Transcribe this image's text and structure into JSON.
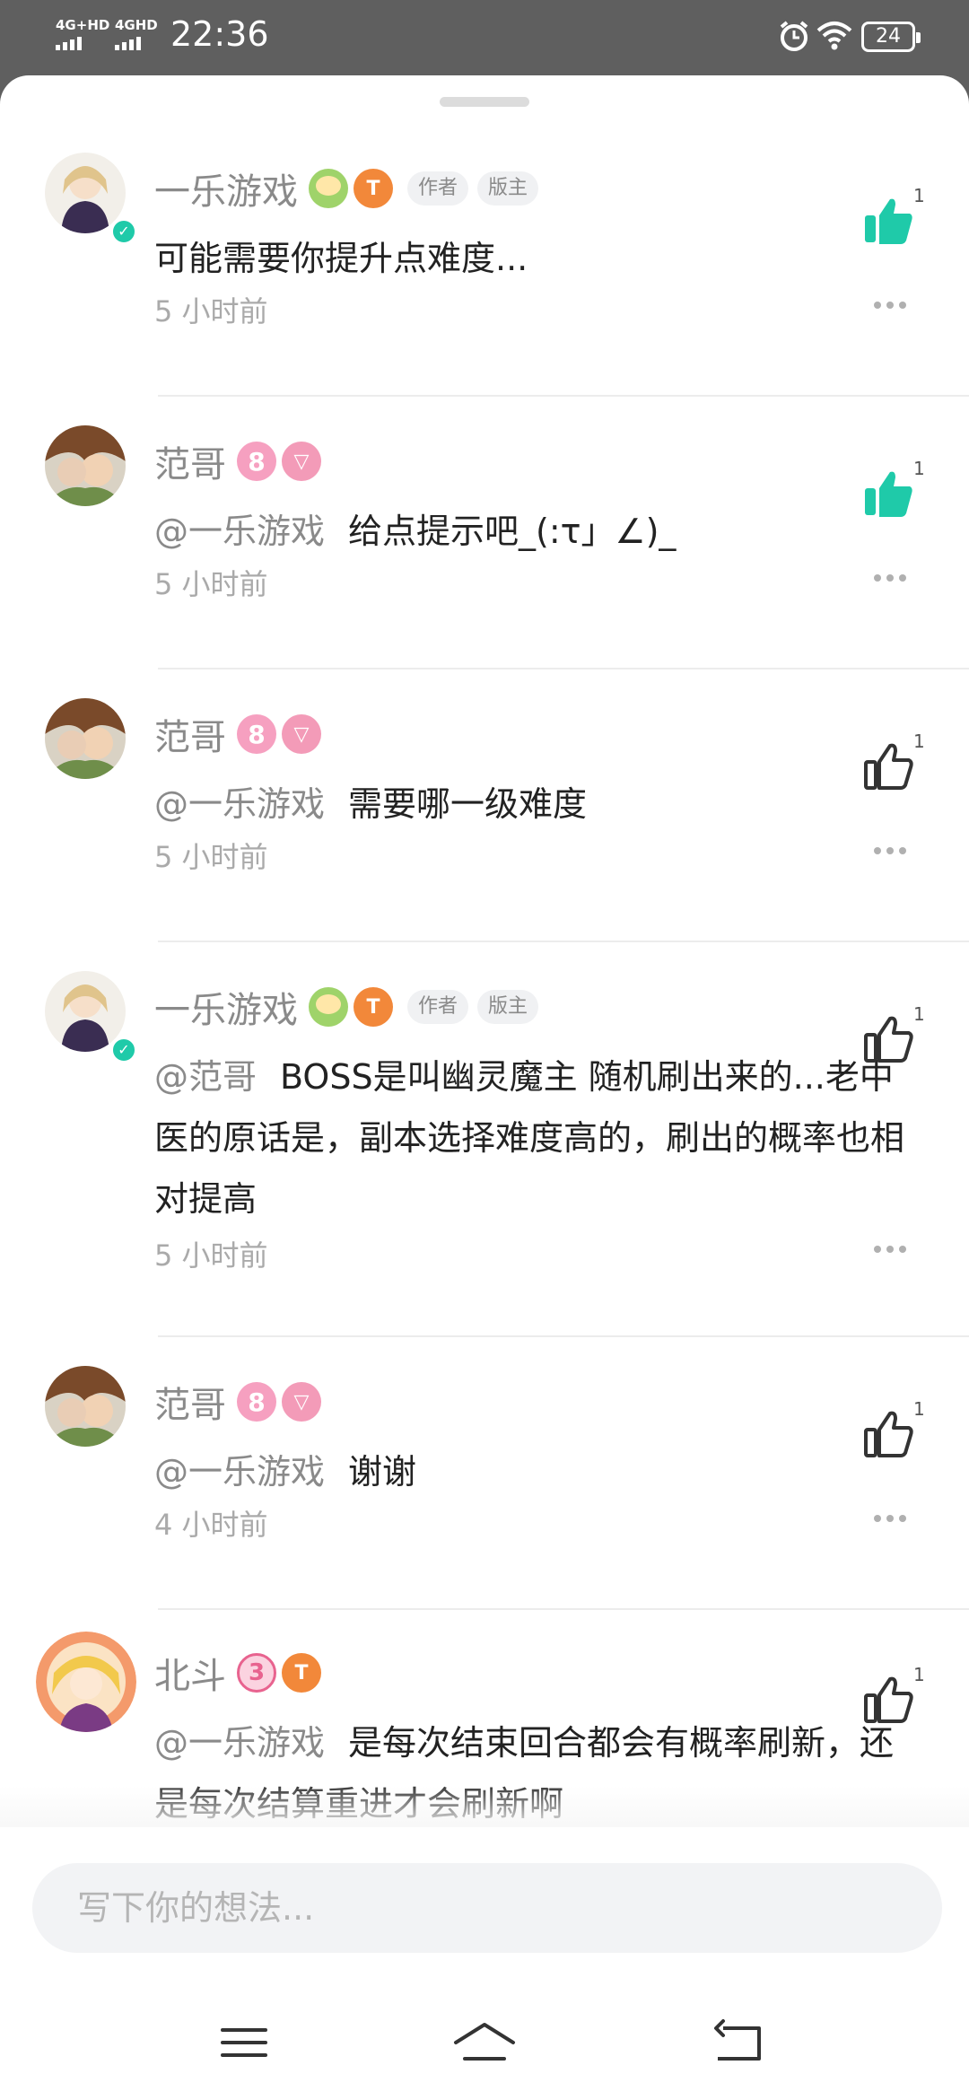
{
  "status_bar": {
    "net1": "4G+HD",
    "net2": "4GHD",
    "time": "22:36",
    "battery": "24"
  },
  "comments": [
    {
      "name": "一乐游戏",
      "tags": [
        "作者",
        "版主"
      ],
      "badges": [
        "face",
        "T10"
      ],
      "mention": "",
      "text": "可能需要你提升点难度...",
      "time": "5 小时前",
      "likes": "1",
      "liked": true
    },
    {
      "name": "范哥",
      "tags": [],
      "badges": [
        "8",
        "V11"
      ],
      "mention": "@一乐游戏",
      "text": "给点提示吧_(:τ」∠)_",
      "time": "5 小时前",
      "likes": "1",
      "liked": true
    },
    {
      "name": "范哥",
      "tags": [],
      "badges": [
        "8",
        "V11"
      ],
      "mention": "@一乐游戏",
      "text": "需要哪一级难度",
      "time": "5 小时前",
      "likes": "1",
      "liked": false
    },
    {
      "name": "一乐游戏",
      "tags": [
        "作者",
        "版主"
      ],
      "badges": [
        "face",
        "T10"
      ],
      "mention": "@范哥",
      "text": "BOSS是叫幽灵魔主 随机刷出来的...老中医的原话是，副本选择难度高的，刷出的概率也相对提高",
      "time": "5 小时前",
      "likes": "1",
      "liked": false
    },
    {
      "name": "范哥",
      "tags": [],
      "badges": [
        "8",
        "V11"
      ],
      "mention": "@一乐游戏",
      "text": "谢谢",
      "time": "4 小时前",
      "likes": "1",
      "liked": false
    },
    {
      "name": "北斗",
      "tags": [],
      "badges": [
        "3",
        "T9"
      ],
      "mention": "@一乐游戏",
      "text": "是每次结束回合都会有概率刷新，还是每次结算重进才会刷新啊",
      "time": "",
      "likes": "1",
      "liked": false
    }
  ],
  "input": {
    "placeholder": "写下你的想法..."
  },
  "colors": {
    "accent": "#1fcaa9",
    "muted_text": "#8a8a8a",
    "status_bar": "#5f5f5f"
  },
  "icons": {
    "like": "thumbs-up-icon",
    "more": "more-dots-icon",
    "nav_menu": "menu-icon",
    "nav_home": "home-icon",
    "nav_back": "back-icon"
  }
}
